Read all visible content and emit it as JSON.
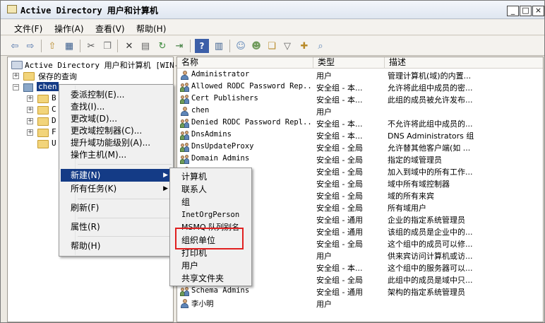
{
  "window": {
    "title": "Active Directory 用户和计算机",
    "minimize": "_",
    "maximize": "□",
    "close": "×"
  },
  "menubar": [
    "文件(F)",
    "操作(A)",
    "查看(V)",
    "帮助(H)"
  ],
  "tree": {
    "root": "Active Directory 用户和计算机 [WIN-",
    "saved_queries": "保存的查询",
    "domain": "chen",
    "children": [
      "B",
      "C",
      "D",
      "F",
      "U"
    ]
  },
  "columns": [
    "名称",
    "类型",
    "描述"
  ],
  "rows": [
    {
      "icon": "user",
      "name": "Administrator",
      "type": "用户",
      "desc": "管理计算机(域)的内置..."
    },
    {
      "icon": "group",
      "name": "Allowed RODC Password Rep...",
      "type": "安全组 - 本...",
      "desc": "允许将此组中成员的密..."
    },
    {
      "icon": "group",
      "name": "Cert Publishers",
      "type": "安全组 - 本...",
      "desc": "此组的成员被允许发布..."
    },
    {
      "icon": "user",
      "name": "chen",
      "type": "用户",
      "desc": ""
    },
    {
      "icon": "group",
      "name": "Denied RODC Password Repl...",
      "type": "安全组 - 本...",
      "desc": "不允许将此组中成员的..."
    },
    {
      "icon": "group",
      "name": "DnsAdmins",
      "type": "安全组 - 本...",
      "desc": "DNS Administrators 组"
    },
    {
      "icon": "group",
      "name": "DnsUpdateProxy",
      "type": "安全组 - 全局",
      "desc": "允许替其他客户端(如 ..."
    },
    {
      "icon": "group",
      "name": "Domain Admins",
      "type": "安全组 - 全局",
      "desc": "指定的域管理员"
    },
    {
      "icon": "group",
      "name": "s",
      "type": "安全组 - 全局",
      "desc": "加入到域中的所有工作..."
    },
    {
      "icon": "group",
      "name": "rs",
      "type": "安全组 - 全局",
      "desc": "域中所有域控制器"
    },
    {
      "icon": "group",
      "name": "",
      "type": "安全组 - 全局",
      "desc": "域的所有来宾"
    },
    {
      "icon": "group",
      "name": "",
      "type": "安全组 - 全局",
      "desc": "所有域用户"
    },
    {
      "icon": "group",
      "name": "ns",
      "type": "安全组 - 通用",
      "desc": "企业的指定系统管理员"
    },
    {
      "icon": "group",
      "name": "Only Doma...",
      "type": "安全组 - 通用",
      "desc": "该组的成员是企业中的..."
    },
    {
      "icon": "group",
      "name": "eator Owners",
      "type": "安全组 - 全局",
      "desc": "这个组中的成员可以修..."
    },
    {
      "icon": "user",
      "name": "",
      "type": "用户",
      "desc": "供来宾访问计算机或访..."
    },
    {
      "icon": "group",
      "name": "vers",
      "type": "安全组 - 本...",
      "desc": "这个组中的服务器可以..."
    },
    {
      "icon": "group",
      "name": "n Controllers",
      "type": "安全组 - 全局",
      "desc": "此组中的成员是域中只..."
    },
    {
      "icon": "group",
      "name": "Schema Admins",
      "type": "安全组 - 通用",
      "desc": "架构的指定系统管理员"
    },
    {
      "icon": "user",
      "name": "李小明",
      "type": "用户",
      "desc": ""
    }
  ],
  "context_menu": {
    "items": [
      "委派控制(E)...",
      "查找(I)...",
      "更改域(D)...",
      "更改域控制器(C)...",
      "提升域功能级别(A)...",
      "操作主机(M)..."
    ],
    "new": "新建(N)",
    "all_tasks": "所有任务(K)",
    "refresh": "刷新(F)",
    "properties": "属性(R)",
    "help": "帮助(H)"
  },
  "submenu": {
    "items": [
      "计算机",
      "联系人",
      "组",
      "InetOrgPerson",
      "MSMQ 队列别名",
      "组织单位",
      "打印机",
      "用户",
      "共享文件夹"
    ],
    "highlighted": "组织单位"
  },
  "colors": {
    "highlight": "#143b86",
    "annotation": "#e02020"
  }
}
